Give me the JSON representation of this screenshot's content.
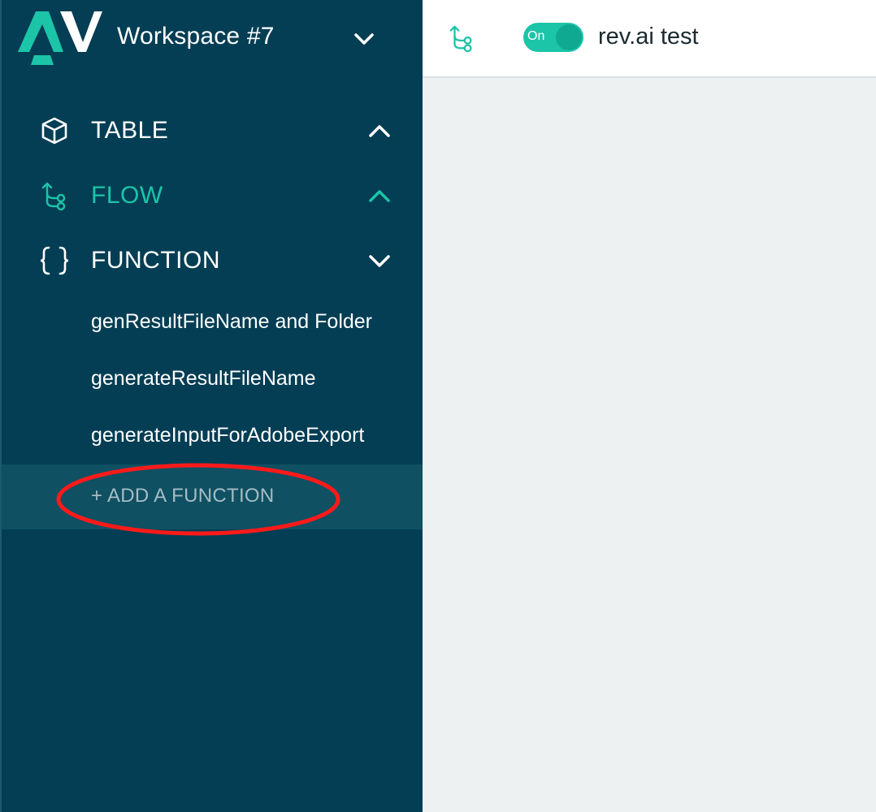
{
  "workspace": {
    "logo_icon": "av-logo",
    "name": "Workspace #7",
    "chevron_icon": "chevron-down-icon"
  },
  "nav": {
    "items": [
      {
        "label": "TABLE",
        "icon": "cube-icon",
        "chevron": "chevron-up-icon",
        "active": false
      },
      {
        "label": "FLOW",
        "icon": "flow-icon",
        "chevron": "chevron-up-icon",
        "active": true
      },
      {
        "label": "FUNCTION",
        "icon": "braces-icon",
        "chevron": "chevron-down-icon",
        "active": false
      }
    ],
    "functions": [
      "genResultFileName and Folder",
      "generateResultFileName",
      "generateInputForAdobeExport"
    ],
    "add_function_label": "+ ADD A FUNCTION"
  },
  "topbar": {
    "icon": "flow-icon",
    "toggle_label": "On",
    "flow_title": "rev.ai test"
  },
  "colors": {
    "sidebar_bg": "#043e54",
    "accent": "#1cc4a8",
    "main_bg": "#eef1f2",
    "annotation": "#ff1a1a"
  }
}
